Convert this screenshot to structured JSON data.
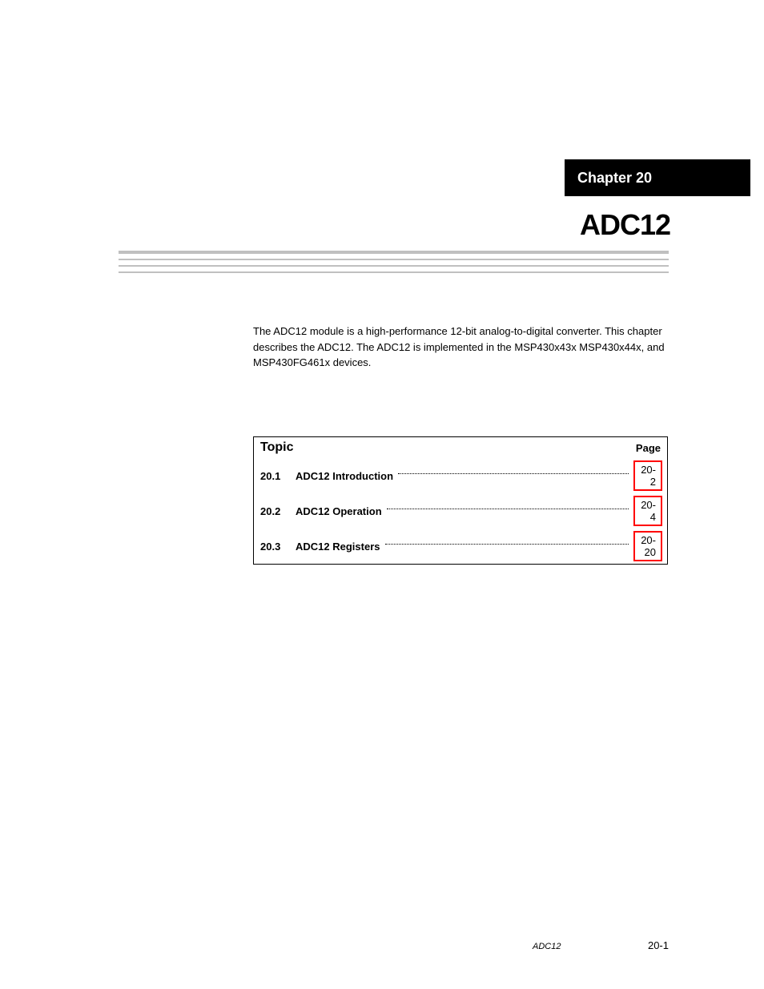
{
  "chapter": {
    "label": "Chapter 20",
    "title": "ADC12"
  },
  "intro": {
    "para1": "The ADC12 module is a high-performance 12-bit analog-to-digital converter. This chapter describes the ADC12. The ADC12 is implemented in the MSP430x43x MSP430x44x, and MSP430FG461x devices.",
    "topicLabel": "Topic",
    "pageLabel": "Page"
  },
  "toc": [
    {
      "num": "20.1",
      "title": "ADC12 Introduction",
      "page": "20-2"
    },
    {
      "num": "20.2",
      "title": "ADC12 Operation",
      "page": "20-4"
    },
    {
      "num": "20.3",
      "title": "ADC12 Registers",
      "page": "20-20"
    }
  ],
  "footer": {
    "label": "ADC12",
    "page": "20-1"
  }
}
